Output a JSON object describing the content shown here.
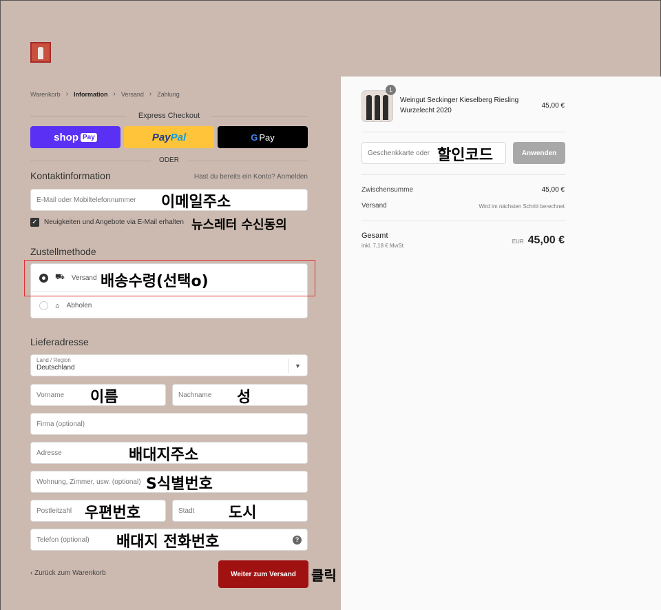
{
  "breadcrumb": {
    "items": [
      "Warenkorb",
      "Information",
      "Versand",
      "Zahlung"
    ]
  },
  "express": {
    "title": "Express Checkout",
    "shop_label": "shop",
    "shop_pay": "Pay",
    "paypal_1": "Pay",
    "paypal_2": "Pal",
    "gpay_g": "G",
    "gpay_label": "Pay",
    "or_label": "ODER"
  },
  "contact": {
    "title": "Kontaktinformation",
    "login_hint": "Hast du bereits ein Konto? Anmelden",
    "email_placeholder": "E-Mail oder Mobiltelefonnummer",
    "newsletter_label": "Neuigkeiten und Angebote via E-Mail erhalten"
  },
  "delivery": {
    "title": "Zustellmethode",
    "option_ship": "Versand",
    "option_pickup": "Abholen"
  },
  "address": {
    "title": "Lieferadresse",
    "country_label": "Land / Region",
    "country_value": "Deutschland",
    "firstname": "Vorname",
    "lastname": "Nachname",
    "company": "Firma (optional)",
    "street": "Adresse",
    "apartment": "Wohnung, Zimmer, usw. (optional)",
    "zip": "Postleitzahl",
    "city": "Stadt",
    "phone": "Telefon (optional)"
  },
  "annotations": {
    "email": "이메일주소",
    "newsletter": "뉴스레터 수신동의",
    "ship": "배송수령(선택o)",
    "firstname": "이름",
    "lastname": "성",
    "street": "배대지주소",
    "apartment": "S식별번호",
    "zip": "우편번호",
    "city": "도시",
    "phone": "배대지 전화번호",
    "click": "클릭",
    "discount": "할인코드"
  },
  "nav": {
    "back": "Zurück zum Warenkorb",
    "continue": "Weiter zum Versand"
  },
  "summary": {
    "product_name": "Weingut Seckinger Kieselberg Riesling Wurzelecht 2020",
    "product_qty": "1",
    "product_price": "45,00 €",
    "gift_placeholder": "Geschenkkarte oder",
    "apply": "Anwenden",
    "subtotal_label": "Zwischensumme",
    "subtotal_value": "45,00 €",
    "shipping_label": "Versand",
    "shipping_value": "Wird im nächsten Schritt berechnet",
    "total_label": "Gesamt",
    "tax_note": "inkl. 7,18 € MwSt",
    "currency": "EUR",
    "total_value": "45,00 €"
  },
  "colors": {
    "accent": "#a01212",
    "page_bg": "#ccbab0",
    "frame": "#e03030",
    "shop_pay": "#5a31f4",
    "paypal": "#ffc439"
  }
}
